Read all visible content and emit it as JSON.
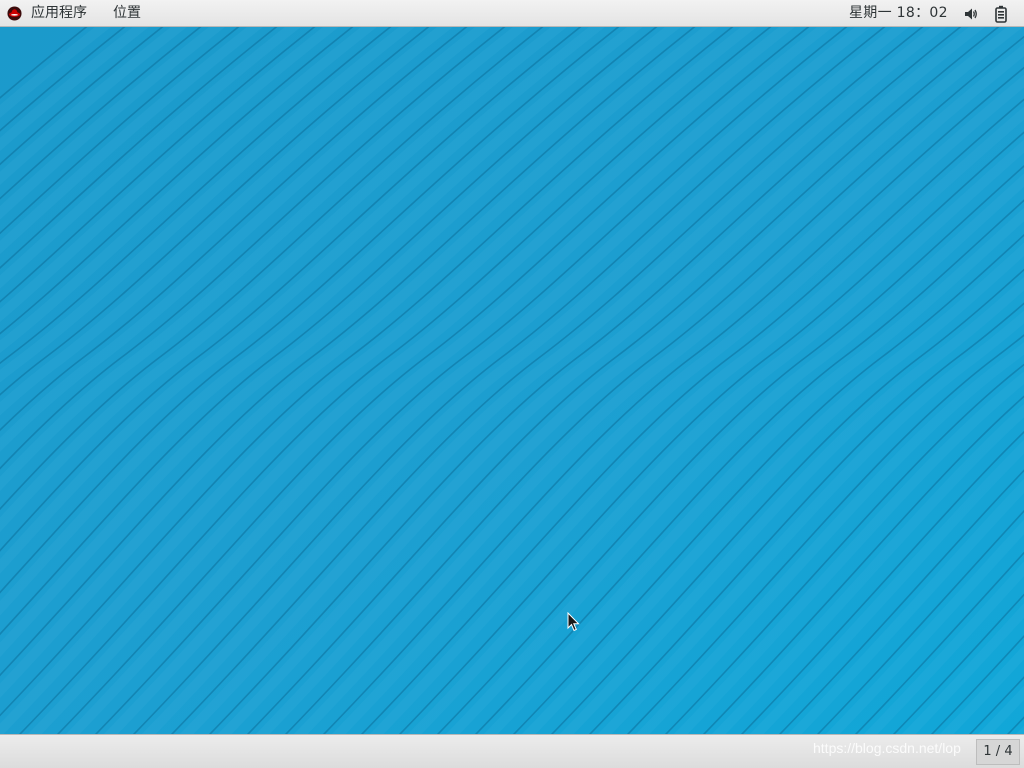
{
  "top_panel": {
    "applications_label": "应用程序",
    "places_label": "位置",
    "clock": "星期一 18：02",
    "logo_icon": "redhat-logo-icon",
    "volume_icon": "volume-icon",
    "power_icon": "power-icon"
  },
  "desktop": {
    "wallpaper_color": "#1a9fd0",
    "line_color": "#0d6f9a"
  },
  "bottom_panel": {
    "watermark": "https://blog.csdn.net/lop",
    "workspace_indicator": "1 / 4"
  },
  "colors": {
    "panel_bg": "#e8e8e8",
    "panel_text": "#2e3436",
    "wallpaper": "#1a9fd0"
  }
}
